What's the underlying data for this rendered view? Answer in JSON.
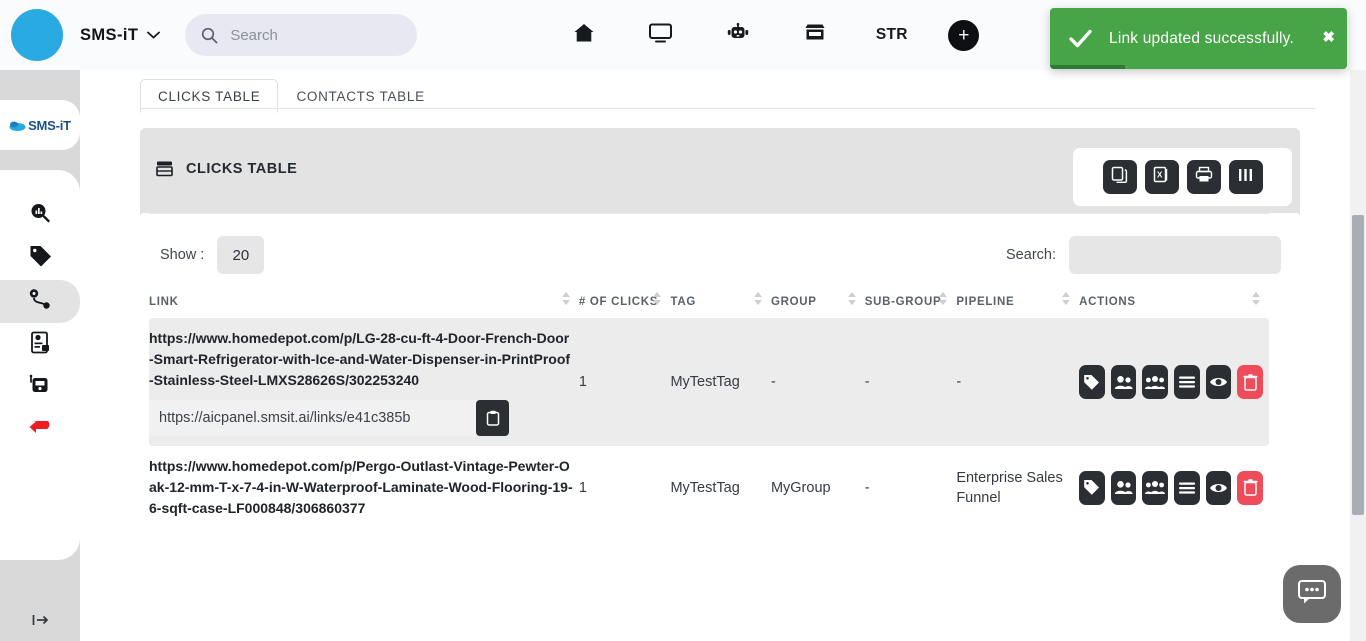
{
  "topbar": {
    "brand": "SMS-iT",
    "caret": "chevron-down",
    "search_placeholder": "Search",
    "search_value": "",
    "nav": [
      {
        "name": "home",
        "label": ""
      },
      {
        "name": "monitor",
        "label": ""
      },
      {
        "name": "robot",
        "label": ""
      },
      {
        "name": "store",
        "label": ""
      },
      {
        "name": "str",
        "label": "STR"
      }
    ],
    "add_label": "+"
  },
  "toast": {
    "message": "Link updated successfully.",
    "close_label": "✖",
    "color": "#47a447"
  },
  "sidebar": {
    "logo_text": "SMS-iT",
    "items": [
      {
        "name": "analytics",
        "active": false
      },
      {
        "name": "tag",
        "active": false
      },
      {
        "name": "links",
        "active": true
      },
      {
        "name": "scan-document",
        "active": false
      },
      {
        "name": "messaging",
        "active": false
      },
      {
        "name": "return",
        "active": false
      }
    ],
    "expand_label": "⇥"
  },
  "main": {
    "tabs": [
      {
        "label": "CLICKS TABLE",
        "active": true
      },
      {
        "label": "CONTACTS TABLE",
        "active": false
      }
    ],
    "card_title": "CLICKS TABLE",
    "toolbar": [
      {
        "name": "copy",
        "label": ""
      },
      {
        "name": "excel",
        "label": ""
      },
      {
        "name": "print",
        "label": ""
      },
      {
        "name": "columns",
        "label": ""
      }
    ],
    "show_label": "Show :",
    "show_value": "20",
    "search_label": "Search:",
    "search_value": "",
    "columns": [
      {
        "key": "link",
        "label": "LINK"
      },
      {
        "key": "clicks",
        "label": "# OF CLICKS"
      },
      {
        "key": "tag",
        "label": "TAG"
      },
      {
        "key": "group",
        "label": "GROUP"
      },
      {
        "key": "subgroup",
        "label": "SUB-GROUP"
      },
      {
        "key": "pipeline",
        "label": "PIPELINE"
      },
      {
        "key": "actions",
        "label": "ACTIONS"
      }
    ],
    "rows": [
      {
        "long_url": "https://www.homedepot.com/p/LG-28-cu-ft-4-Door-French-Door-Smart-Refrigerator-with-Ice-and-Water-Dispenser-in-PrintProof-Stainless-Steel-LMXS28626S/302253240",
        "short_url": "https://aicpanel.smsit.ai/links/e41c385b",
        "clicks": "1",
        "tag": "MyTestTag",
        "group": "-",
        "subgroup": "-",
        "pipeline": "-"
      },
      {
        "long_url": "https://www.homedepot.com/p/Pergo-Outlast-Vintage-Pewter-Oak-12-mm-T-x-7-4-in-W-Waterproof-Laminate-Wood-Flooring-19-6-sqft-case-LF000848/306860377",
        "short_url": "",
        "clicks": "1",
        "tag": "MyTestTag",
        "group": "MyGroup",
        "subgroup": "-",
        "pipeline": "Enterprise Sales Funnel"
      }
    ],
    "row_actions": [
      {
        "name": "tag",
        "label": ""
      },
      {
        "name": "contacts",
        "label": ""
      },
      {
        "name": "groups",
        "label": ""
      },
      {
        "name": "pipeline",
        "label": ""
      },
      {
        "name": "view",
        "label": ""
      },
      {
        "name": "delete",
        "label": ""
      }
    ]
  },
  "chat": {
    "label": "chat-bubble"
  }
}
